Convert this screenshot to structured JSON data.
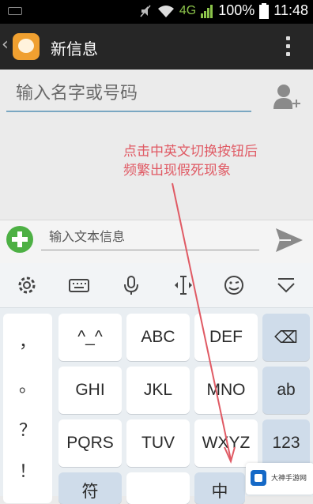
{
  "status_bar": {
    "network": "4G",
    "battery": "100%",
    "time": "11:48"
  },
  "action_bar": {
    "back_glyph": "‹",
    "title": "新信息"
  },
  "recipient": {
    "placeholder": "输入名字或号码"
  },
  "annotation": {
    "line1": "点击中英文切换按钮后",
    "line2": "频繁出现假死现象",
    "color": "#e05a64"
  },
  "compose": {
    "placeholder": "输入文本信息"
  },
  "keyboard": {
    "symbols": [
      "，",
      "。",
      "？",
      "！"
    ],
    "row1": [
      "^_^",
      "ABC",
      "DEF"
    ],
    "row2": [
      "GHI",
      "JKL",
      "MNO"
    ],
    "row3": [
      "PQRS",
      "TUV",
      "WXYZ"
    ],
    "row4": [
      "符",
      "",
      "中"
    ],
    "side": {
      "delete": "⌫",
      "ab": "ab",
      "num": "123"
    }
  },
  "watermark": {
    "text": "大神手游网"
  }
}
